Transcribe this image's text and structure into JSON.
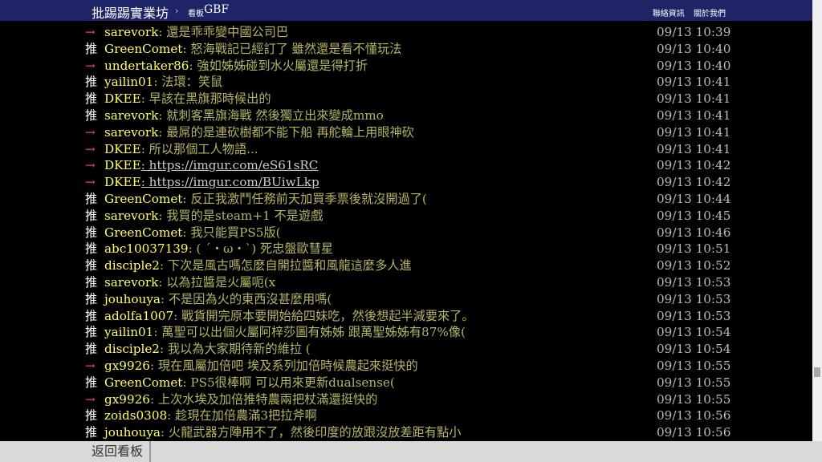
{
  "header": {
    "brand": "批踢踢實業坊",
    "separator": "›",
    "board_label": "看板",
    "board_name": "GBF",
    "links": [
      "聯絡資訊",
      "關於我們"
    ]
  },
  "comments": [
    {
      "tag": "→",
      "type": "arrow",
      "user": "sarevork",
      "text": ": 還是乖乖變中國公司巴",
      "time": "09/13 10:39"
    },
    {
      "tag": "推",
      "type": "push",
      "user": "GreenComet",
      "text": ": 怒海戰記已經訂了 雖然還是看不懂玩法",
      "time": "09/13 10:40"
    },
    {
      "tag": "→",
      "type": "arrow",
      "user": "undertaker86",
      "text": ": 強如姊姊碰到水火屬還是得打折",
      "time": "09/13 10:40"
    },
    {
      "tag": "推",
      "type": "push",
      "user": "yailin01",
      "text": ": 法環：笑鼠",
      "time": "09/13 10:41"
    },
    {
      "tag": "推",
      "type": "push",
      "user": "DKEE",
      "text": ": 早該在黑旗那時候出的",
      "time": "09/13 10:41"
    },
    {
      "tag": "推",
      "type": "push",
      "user": "sarevork",
      "text": ": 就刺客黑旗海戰 然後獨立出來變成mmo",
      "time": "09/13 10:41"
    },
    {
      "tag": "→",
      "type": "arrow",
      "user": "sarevork",
      "text": ": 最屌的是連砍樹都不能下船 再舵輪上用眼神砍",
      "time": "09/13 10:41"
    },
    {
      "tag": "→",
      "type": "arrow",
      "user": "DKEE",
      "text": ": 所以那個工人物語...",
      "time": "09/13 10:41"
    },
    {
      "tag": "→",
      "type": "arrow",
      "user": "DKEE",
      "text": ": https://imgur.com/eS61sRC",
      "time": "09/13 10:42",
      "link": true
    },
    {
      "tag": "→",
      "type": "arrow",
      "user": "DKEE",
      "text": ": https://imgur.com/BUiwLkp",
      "time": "09/13 10:42",
      "link": true
    },
    {
      "tag": "推",
      "type": "push",
      "user": "GreenComet",
      "text": ": 反正我激鬥任務前天加買季票後就沒開過了(",
      "time": "09/13 10:44"
    },
    {
      "tag": "推",
      "type": "push",
      "user": "sarevork",
      "text": ": 我買的是steam+1 不是遊戲",
      "time": "09/13 10:45"
    },
    {
      "tag": "推",
      "type": "push",
      "user": "GreenComet",
      "text": ": 我只能買PS5版(",
      "time": "09/13 10:46"
    },
    {
      "tag": "推",
      "type": "push",
      "user": "abc10037139",
      "text": ": ( ´・ω・`) 死忠盤歐彗星",
      "time": "09/13 10:51"
    },
    {
      "tag": "推",
      "type": "push",
      "user": "disciple2",
      "text": ": 下次是風古嗎怎麼自開拉醬和風龍這麼多人進",
      "time": "09/13 10:52"
    },
    {
      "tag": "推",
      "type": "push",
      "user": "sarevork",
      "text": ": 以為拉醬是火屬呃(x",
      "time": "09/13 10:53"
    },
    {
      "tag": "推",
      "type": "push",
      "user": "jouhouya",
      "text": ": 不是因為火的東西沒甚麼用嗎(",
      "time": "09/13 10:53"
    },
    {
      "tag": "推",
      "type": "push",
      "user": "adolfa1007",
      "text": ": 戰貨開完原本要開始給四妹吃，然後想起半減要來了。",
      "time": "09/13 10:53"
    },
    {
      "tag": "推",
      "type": "push",
      "user": "yailin01",
      "text": ": 萬聖可以出個火屬阿梓莎圖有姊姊 跟萬聖姊姊有87%像(",
      "time": "09/13 10:54"
    },
    {
      "tag": "推",
      "type": "push",
      "user": "disciple2",
      "text": ": 我以為大家期待新的維拉 (",
      "time": "09/13 10:54"
    },
    {
      "tag": "→",
      "type": "arrow",
      "user": "gx9926",
      "text": ": 現在風屬加倍吧 埃及系列加倍時候農起來挺快的",
      "time": "09/13 10:55"
    },
    {
      "tag": "推",
      "type": "push",
      "user": "GreenComet",
      "text": ": PS5很棒啊 可以用來更新dualsense(",
      "time": "09/13 10:55"
    },
    {
      "tag": "→",
      "type": "arrow",
      "user": "gx9926",
      "text": ": 上次水埃及加倍推特農兩把杖滿還挺快的",
      "time": "09/13 10:55"
    },
    {
      "tag": "推",
      "type": "push",
      "user": "zoids0308",
      "text": ": 趁現在加倍農滿3把拉斧啊",
      "time": "09/13 10:56"
    },
    {
      "tag": "推",
      "type": "push",
      "user": "jouhouya",
      "text": ": 火龍武器方陣用不了，然後印度的放跟沒放差距有點小",
      "time": "09/13 10:56"
    }
  ],
  "footer": {
    "back_label": "返回看板"
  }
}
